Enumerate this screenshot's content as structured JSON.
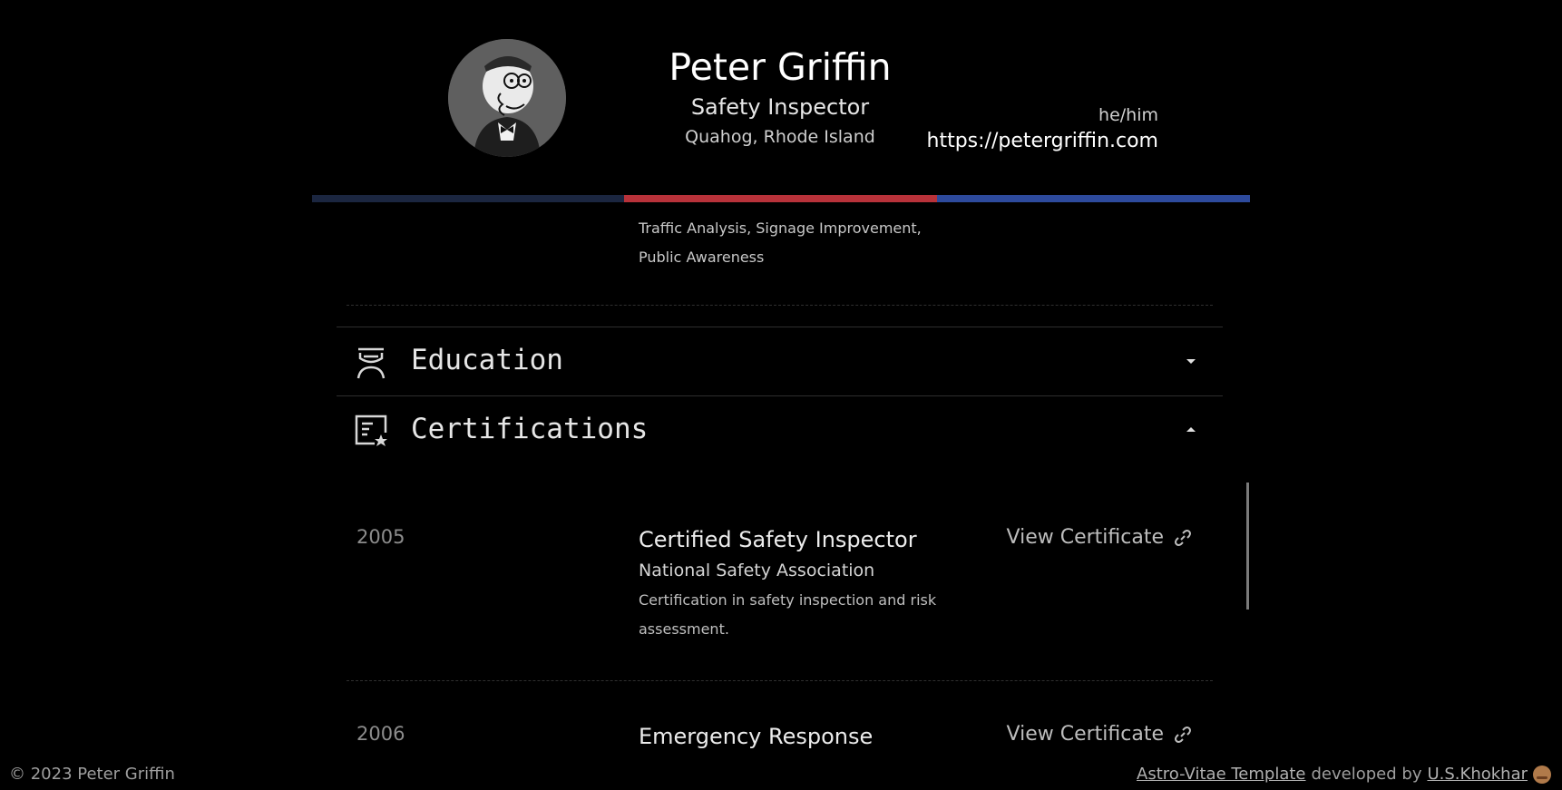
{
  "profile": {
    "name": "Peter Griffin",
    "title": "Safety Inspector",
    "location": "Quahog, Rhode Island",
    "pronouns": "he/him",
    "website": "https://petergriffin.com"
  },
  "previous_section": {
    "tags_line1": "Traffic Analysis, Signage Improvement,",
    "tags_line2": "Public Awareness"
  },
  "sections": {
    "education": {
      "label": "Education",
      "icon": "graduate-icon",
      "state": "collapsed"
    },
    "certifications": {
      "label": "Certifications",
      "icon": "certificate-icon",
      "state": "expanded"
    }
  },
  "certifications": [
    {
      "year": "2005",
      "name": "Certified Safety Inspector",
      "org": "National Safety Association",
      "desc": "Certification in safety inspection and risk assessment.",
      "link_label": "View Certificate"
    },
    {
      "year": "2006",
      "name": "Emergency Response",
      "link_label": "View Certificate"
    }
  ],
  "footer": {
    "copyright": "© 2023 Peter Griffin",
    "template_link": "Astro-Vitae Template",
    "developed_by": "developed by",
    "author_link": "U.S.Khokhar"
  },
  "colors": {
    "stripe_1": "#1b2640",
    "stripe_2": "#b8323a",
    "stripe_3": "#2d4a9c",
    "background": "#000000"
  }
}
